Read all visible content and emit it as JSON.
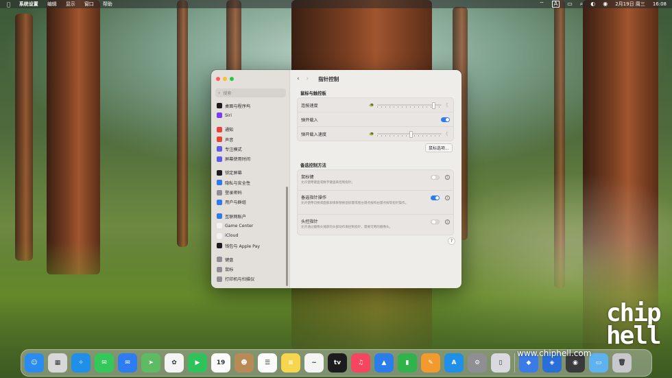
{
  "menubar": {
    "app_name": "系统设置",
    "menus": [
      "编辑",
      "显示",
      "窗口",
      "帮助"
    ],
    "input_indicator": "A",
    "datetime": "2月19日 周三",
    "time": "16:08"
  },
  "window": {
    "title": "指针控制",
    "search_placeholder": "搜索",
    "sidebar": [
      {
        "label": "桌面与程序坞",
        "icon": "dock-icon",
        "color": "#1c1c1e"
      },
      {
        "label": "Siri",
        "icon": "siri-icon",
        "color": "#7a3cf0"
      },
      {
        "label": "通知",
        "icon": "bell-icon",
        "color": "#e8433b"
      },
      {
        "label": "声音",
        "icon": "speaker-icon",
        "color": "#e8433b"
      },
      {
        "label": "专注模式",
        "icon": "moon-icon",
        "color": "#5e5ce6"
      },
      {
        "label": "屏幕使用时间",
        "icon": "hourglass-icon",
        "color": "#5e5ce6"
      },
      {
        "label": "锁定屏幕",
        "icon": "lock-icon",
        "color": "#1c1c1e"
      },
      {
        "label": "隐私与安全性",
        "icon": "hand-icon",
        "color": "#2f7af0"
      },
      {
        "label": "登录密码",
        "icon": "key-icon",
        "color": "#8e8e93"
      },
      {
        "label": "用户与群组",
        "icon": "users-icon",
        "color": "#2f7af0"
      },
      {
        "label": "互联网账户",
        "icon": "at-icon",
        "color": "#2f7af0"
      },
      {
        "label": "Game Center",
        "icon": "gamecenter-icon",
        "color": "#f2f2f2"
      },
      {
        "label": "iCloud",
        "icon": "cloud-icon",
        "color": "#f2f2f2"
      },
      {
        "label": "钱包与 Apple Pay",
        "icon": "wallet-icon",
        "color": "#1c1c1e"
      },
      {
        "label": "键盘",
        "icon": "keyboard-icon",
        "color": "#8e8e93"
      },
      {
        "label": "鼠标",
        "icon": "mouse-icon",
        "color": "#8e8e93"
      },
      {
        "label": "打印机与扫描仪",
        "icon": "printer-icon",
        "color": "#8e8e93"
      }
    ],
    "section1": {
      "title": "鼠标与触控板",
      "double_click_label": "连按速度",
      "double_click_level": 0.85,
      "spring_loading_label": "弹开载入",
      "spring_loading_on": true,
      "spring_speed_label": "弹开载入速度",
      "spring_speed_level": 0.5,
      "options_button": "鼠标选项..."
    },
    "section2": {
      "title": "备选控制方法",
      "items": [
        {
          "label": "鼠标键",
          "desc": "允许使用键盘或数字键盘来控制指针。",
          "on": false
        },
        {
          "label": "备选指针操作",
          "desc": "允许使用切换或面部表情来替换鼠标键或者左键点按和右键点按等指针操作。",
          "on": true
        },
        {
          "label": "头控指针",
          "desc": "允许通过摄像头捕获的头部动作来控制指针，需要可用的摄像头。",
          "on": false
        }
      ],
      "help_label": "?"
    }
  },
  "dock": {
    "apps": [
      {
        "name": "finder-icon",
        "color": "#2a8cf0",
        "glyph": "☺"
      },
      {
        "name": "launchpad-icon",
        "color": "#d8d8d8",
        "glyph": "▦"
      },
      {
        "name": "safari-icon",
        "color": "#1f8fe8",
        "glyph": "✧"
      },
      {
        "name": "messages-icon",
        "color": "#34c759",
        "glyph": "✉"
      },
      {
        "name": "mail-icon",
        "color": "#2d7df0",
        "glyph": "✉"
      },
      {
        "name": "maps-icon",
        "color": "#5dbb63",
        "glyph": "➤"
      },
      {
        "name": "photos-icon",
        "color": "#f4f4f4",
        "glyph": "✿"
      },
      {
        "name": "facetime-icon",
        "color": "#30c25a",
        "glyph": "▶"
      },
      {
        "name": "calendar-icon",
        "color": "#fbfbfb",
        "glyph": "19"
      },
      {
        "name": "contacts-icon",
        "color": "#b88a55",
        "glyph": "☻"
      },
      {
        "name": "reminders-icon",
        "color": "#fbfbfb",
        "glyph": "☰"
      },
      {
        "name": "notes-icon",
        "color": "#f6d64e",
        "glyph": "≡"
      },
      {
        "name": "freeform-icon",
        "color": "#f4f4f4",
        "glyph": "~"
      },
      {
        "name": "appletv-icon",
        "color": "#1c1c1e",
        "glyph": "tv"
      },
      {
        "name": "music-icon",
        "color": "#f5455f",
        "glyph": "♫"
      },
      {
        "name": "keynote-icon",
        "color": "#2b7de9",
        "glyph": "▲"
      },
      {
        "name": "numbers-icon",
        "color": "#2fb34a",
        "glyph": "▮"
      },
      {
        "name": "pages-icon",
        "color": "#f29a2e",
        "glyph": "✎"
      },
      {
        "name": "appstore-icon",
        "color": "#1f8fe8",
        "glyph": "A"
      },
      {
        "name": "systemsettings-icon",
        "color": "#8e8e93",
        "glyph": "⚙"
      },
      {
        "name": "iphone-mirroring-icon",
        "color": "#d9d9df",
        "glyph": "▯"
      }
    ],
    "right_apps": [
      {
        "name": "screensharing-icon",
        "color": "#3a7be8",
        "glyph": "◆"
      },
      {
        "name": "preview-icon",
        "color": "#2a6fd8",
        "glyph": "◈"
      },
      {
        "name": "camera-icon",
        "color": "#3a3a3c",
        "glyph": "◉"
      },
      {
        "name": "downloads-folder-icon",
        "color": "#5fb2f0",
        "glyph": "▭"
      },
      {
        "name": "trash-icon",
        "color": "#c8c8cc",
        "glyph": "🗑"
      }
    ]
  },
  "watermark": {
    "url": "www.chiphell.com",
    "logo": "chip hell"
  }
}
